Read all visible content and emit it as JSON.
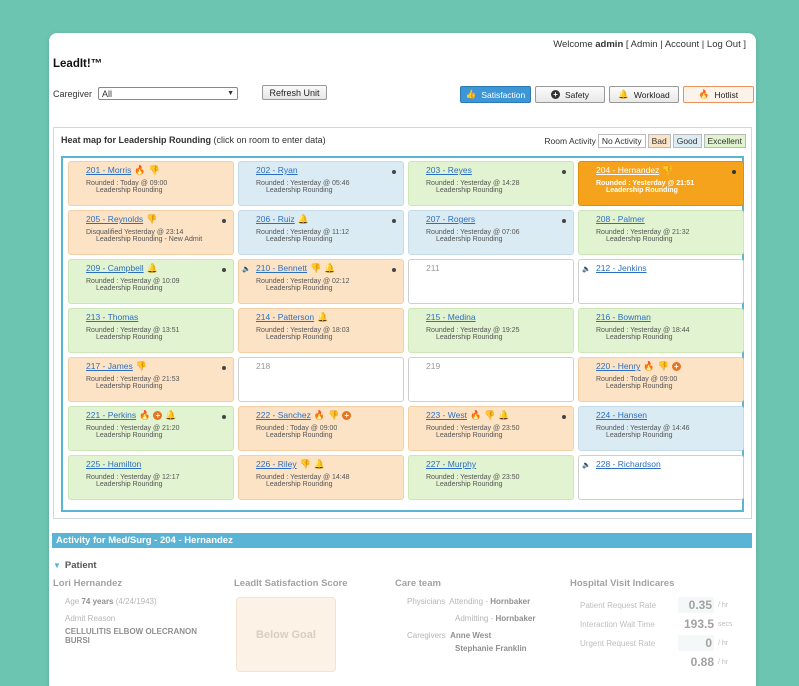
{
  "topnav": {
    "welcome": "Welcome",
    "user": "admin",
    "admin": "Admin",
    "account": "Account",
    "logout": "Log Out"
  },
  "app": {
    "title": "LeadIt!™"
  },
  "caregiver": {
    "label": "Caregiver",
    "value": "All"
  },
  "refresh_label": "Refresh Unit",
  "modes": [
    {
      "label": "Satisfaction",
      "icon": "thumbs-up-icon",
      "active": true
    },
    {
      "label": "Safety",
      "icon": "plus-icon"
    },
    {
      "label": "Workload",
      "icon": "bell-icon"
    },
    {
      "label": "Hotlist",
      "icon": "flame-icon"
    }
  ],
  "heatmap": {
    "title": "Heat map for Leadership Rounding",
    "hint": "(click on room to enter data)",
    "legend_label": "Room Activity",
    "legend": [
      "No Activity",
      "Bad",
      "Good",
      "Excellent"
    ]
  },
  "rooms": [
    {
      "name": "201 - Morris",
      "status": "orange",
      "icons": [
        "🔥",
        "👎"
      ],
      "line1": "Rounded : Today @ 09:00",
      "line2": "Leadership Rounding"
    },
    {
      "name": "202 - Ryan",
      "status": "blue",
      "icons": [],
      "dot": true,
      "line1": "Rounded : Yesterday @ 05:46",
      "line2": "Leadership Rounding"
    },
    {
      "name": "203 - Reyes",
      "status": "green",
      "icons": [],
      "dot": true,
      "line1": "Rounded : Yesterday @ 14:28",
      "line2": "Leadership Rounding"
    },
    {
      "name": "204 - Hernandez",
      "status": "active",
      "icons": [
        "👎"
      ],
      "dot": true,
      "line1": "Rounded : Yesterday @ 21:51",
      "line2": "Leadership Rounding"
    },
    {
      "name": "205 - Reynolds",
      "status": "orange",
      "icons": [
        "👎"
      ],
      "dot": true,
      "line1": "Disqualified Yesterday @ 23:14",
      "line2": "Leadership Rounding - New Admit"
    },
    {
      "name": "206 - Ruiz",
      "status": "blue",
      "icons": [
        "🔔"
      ],
      "dot": true,
      "line1": "Rounded : Yesterday @ 11:12",
      "line2": "Leadership Rounding"
    },
    {
      "name": "207 - Rogers",
      "status": "blue",
      "icons": [],
      "dot": true,
      "line1": "Rounded : Yesterday @ 07:06",
      "line2": "Leadership Rounding"
    },
    {
      "name": "208 - Palmer",
      "status": "green",
      "icons": [],
      "line1": "Rounded : Yesterday @ 21:32",
      "line2": "Leadership Rounding"
    },
    {
      "name": "209 - Campbell",
      "status": "green",
      "icons": [
        "🔔"
      ],
      "dot": true,
      "line1": "Rounded : Yesterday @ 10:09",
      "line2": "Leadership Rounding"
    },
    {
      "name": "210 - Bennett",
      "status": "orange",
      "speaker": true,
      "icons": [
        "👎",
        "🔔"
      ],
      "dot": true,
      "line1": "Rounded : Yesterday @ 02:12",
      "line2": "Leadership Rounding"
    },
    {
      "name": "211",
      "status": "white",
      "empty": true
    },
    {
      "name": "212 - Jenkins",
      "status": "white",
      "speaker": true,
      "icons": [],
      "line1": "",
      "line2": ""
    },
    {
      "name": "213 - Thomas",
      "status": "green",
      "icons": [],
      "line1": "Rounded : Yesterday @ 13:51",
      "line2": "Leadership Rounding"
    },
    {
      "name": "214 - Patterson",
      "status": "orange",
      "icons": [
        "🔔"
      ],
      "line1": "Rounded : Yesterday @ 18:03",
      "line2": "Leadership Rounding"
    },
    {
      "name": "215 - Medina",
      "status": "green",
      "icons": [],
      "line1": "Rounded : Yesterday @ 19:25",
      "line2": "Leadership Rounding"
    },
    {
      "name": "216 - Bowman",
      "status": "green",
      "icons": [],
      "line1": "Rounded : Yesterday @ 18:44",
      "line2": "Leadership Rounding"
    },
    {
      "name": "217 - James",
      "status": "orange",
      "icons": [
        "👎"
      ],
      "dot": true,
      "line1": "Rounded : Yesterday @ 21:53",
      "line2": "Leadership Rounding"
    },
    {
      "name": "218",
      "status": "white",
      "empty": true
    },
    {
      "name": "219",
      "status": "white",
      "empty": true
    },
    {
      "name": "220 - Henry",
      "status": "orange",
      "icons": [
        "🔥",
        "👎",
        "+"
      ],
      "line1": "Rounded : Today @ 09:00",
      "line2": "Leadership Rounding"
    },
    {
      "name": "221 - Perkins",
      "status": "green",
      "icons": [
        "🔥",
        "+",
        "🔔"
      ],
      "dot": true,
      "line1": "Rounded : Yesterday @ 21:20",
      "line2": "Leadership Rounding"
    },
    {
      "name": "222 - Sanchez",
      "status": "orange",
      "icons": [
        "🔥",
        "👎",
        "+"
      ],
      "line1": "Rounded : Today @ 09:00",
      "line2": "Leadership Rounding"
    },
    {
      "name": "223 - West",
      "status": "orange",
      "icons": [
        "🔥",
        "👎",
        "🔔"
      ],
      "dot": true,
      "line1": "Rounded : Yesterday @ 23:50",
      "line2": "Leadership Rounding"
    },
    {
      "name": "224 - Hansen",
      "status": "blue",
      "icons": [],
      "line1": "Rounded : Yesterday @ 14:46",
      "line2": "Leadership Rounding"
    },
    {
      "name": "225 - Hamilton",
      "status": "green",
      "icons": [],
      "line1": "Rounded : Yesterday @ 12:17",
      "line2": "Leadership Rounding"
    },
    {
      "name": "226 - Riley",
      "status": "orange",
      "icons": [
        "👎",
        "🔔"
      ],
      "line1": "Rounded : Yesterday @ 14:48",
      "line2": "Leadership Rounding"
    },
    {
      "name": "227 - Murphy",
      "status": "green",
      "icons": [],
      "line1": "Rounded : Yesterday @ 23:50",
      "line2": "Leadership Rounding"
    },
    {
      "name": "228 - Richardson",
      "status": "white",
      "speaker": true,
      "icons": [],
      "line1": "",
      "line2": ""
    }
  ],
  "activity": {
    "title": "Activity for Med/Surg - 204 - Hernandez"
  },
  "patient": {
    "section": "Patient",
    "name": "Lori Hernandez",
    "age_label": "Age",
    "age": "74 years",
    "dob": "(4/24/1943)",
    "reason_label": "Admit Reason",
    "reason": "CELLULITIS ELBOW OLECRANON BURSI"
  },
  "score": {
    "title": "LeadIt Satisfaction Score",
    "value": "Below Goal"
  },
  "care": {
    "title": "Care team",
    "physicians_label": "Physicians",
    "attending_label": "Attending -",
    "attending": "Hornbaker",
    "admitting_label": "Admitting -",
    "admitting": "Hornbaker",
    "caregivers_label": "Caregivers",
    "caregivers": [
      "Anne West",
      "Stephanie Franklin"
    ]
  },
  "visit": {
    "title": "Hospital Visit Indicares",
    "metrics": [
      {
        "label": "Patient Request Rate",
        "value": "0.35",
        "unit": "/ hr"
      },
      {
        "label": "Interaction Wait Time",
        "value": "193.5",
        "unit": "secs"
      },
      {
        "label": "Urgent Request Rate",
        "value": "0",
        "unit": "/ hr"
      },
      {
        "label": "",
        "value": "0.88",
        "unit": "/ hr"
      }
    ]
  }
}
